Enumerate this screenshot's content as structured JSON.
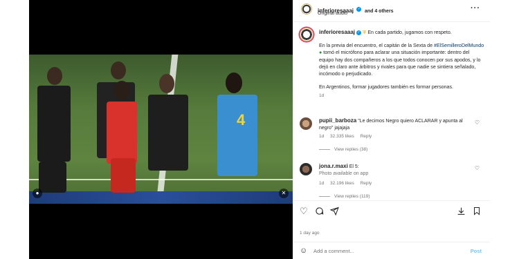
{
  "header": {
    "username": "inferioresaaaj",
    "and_others": "and 4 others",
    "audio": "Original audio",
    "more_icon": "more-horizontal-icon"
  },
  "post": {
    "username": "inferioresaaaj",
    "headline": "En cada partido, jugamos con respeto.",
    "caption_part1": "En la previa del encuentro, el capitán de la Sexta de ",
    "hashtag": "#ElSemilleroDelMundo",
    "caption_part2": " tomó el micrófono para aclarar una situación importante: dentro del equipo hay dos compañeros a los que todos conocen por sus apodos, y lo dejó en claro ante árbitros y rivales para que nadie se sintiera señalado, incómodo o perjudicado.",
    "caption_p2": "En Argentinos, formar jugadores también es formar personas.",
    "time": "1d"
  },
  "comments": [
    {
      "username": "pupii_barboza",
      "text": "\"Le decimos Negro quiero ACLARAR y apunta al negro\" jajajaja",
      "time": "1d",
      "likes": "32.335 likes",
      "reply": "Reply",
      "view_replies": "View replies (38)"
    },
    {
      "username": "jona.r.maxi",
      "text": "El 5:",
      "extra": "Photo available on app",
      "time": "1d",
      "likes": "32.196 likes",
      "reply": "Reply",
      "view_replies": "View replies (119)"
    }
  ],
  "footer": {
    "date": "1 day ago",
    "add_comment_placeholder": "Add a comment...",
    "post_label": "Post"
  },
  "colors": {
    "verified": "#0095f6",
    "link": "#00376b",
    "post_button": "#0095f6"
  }
}
